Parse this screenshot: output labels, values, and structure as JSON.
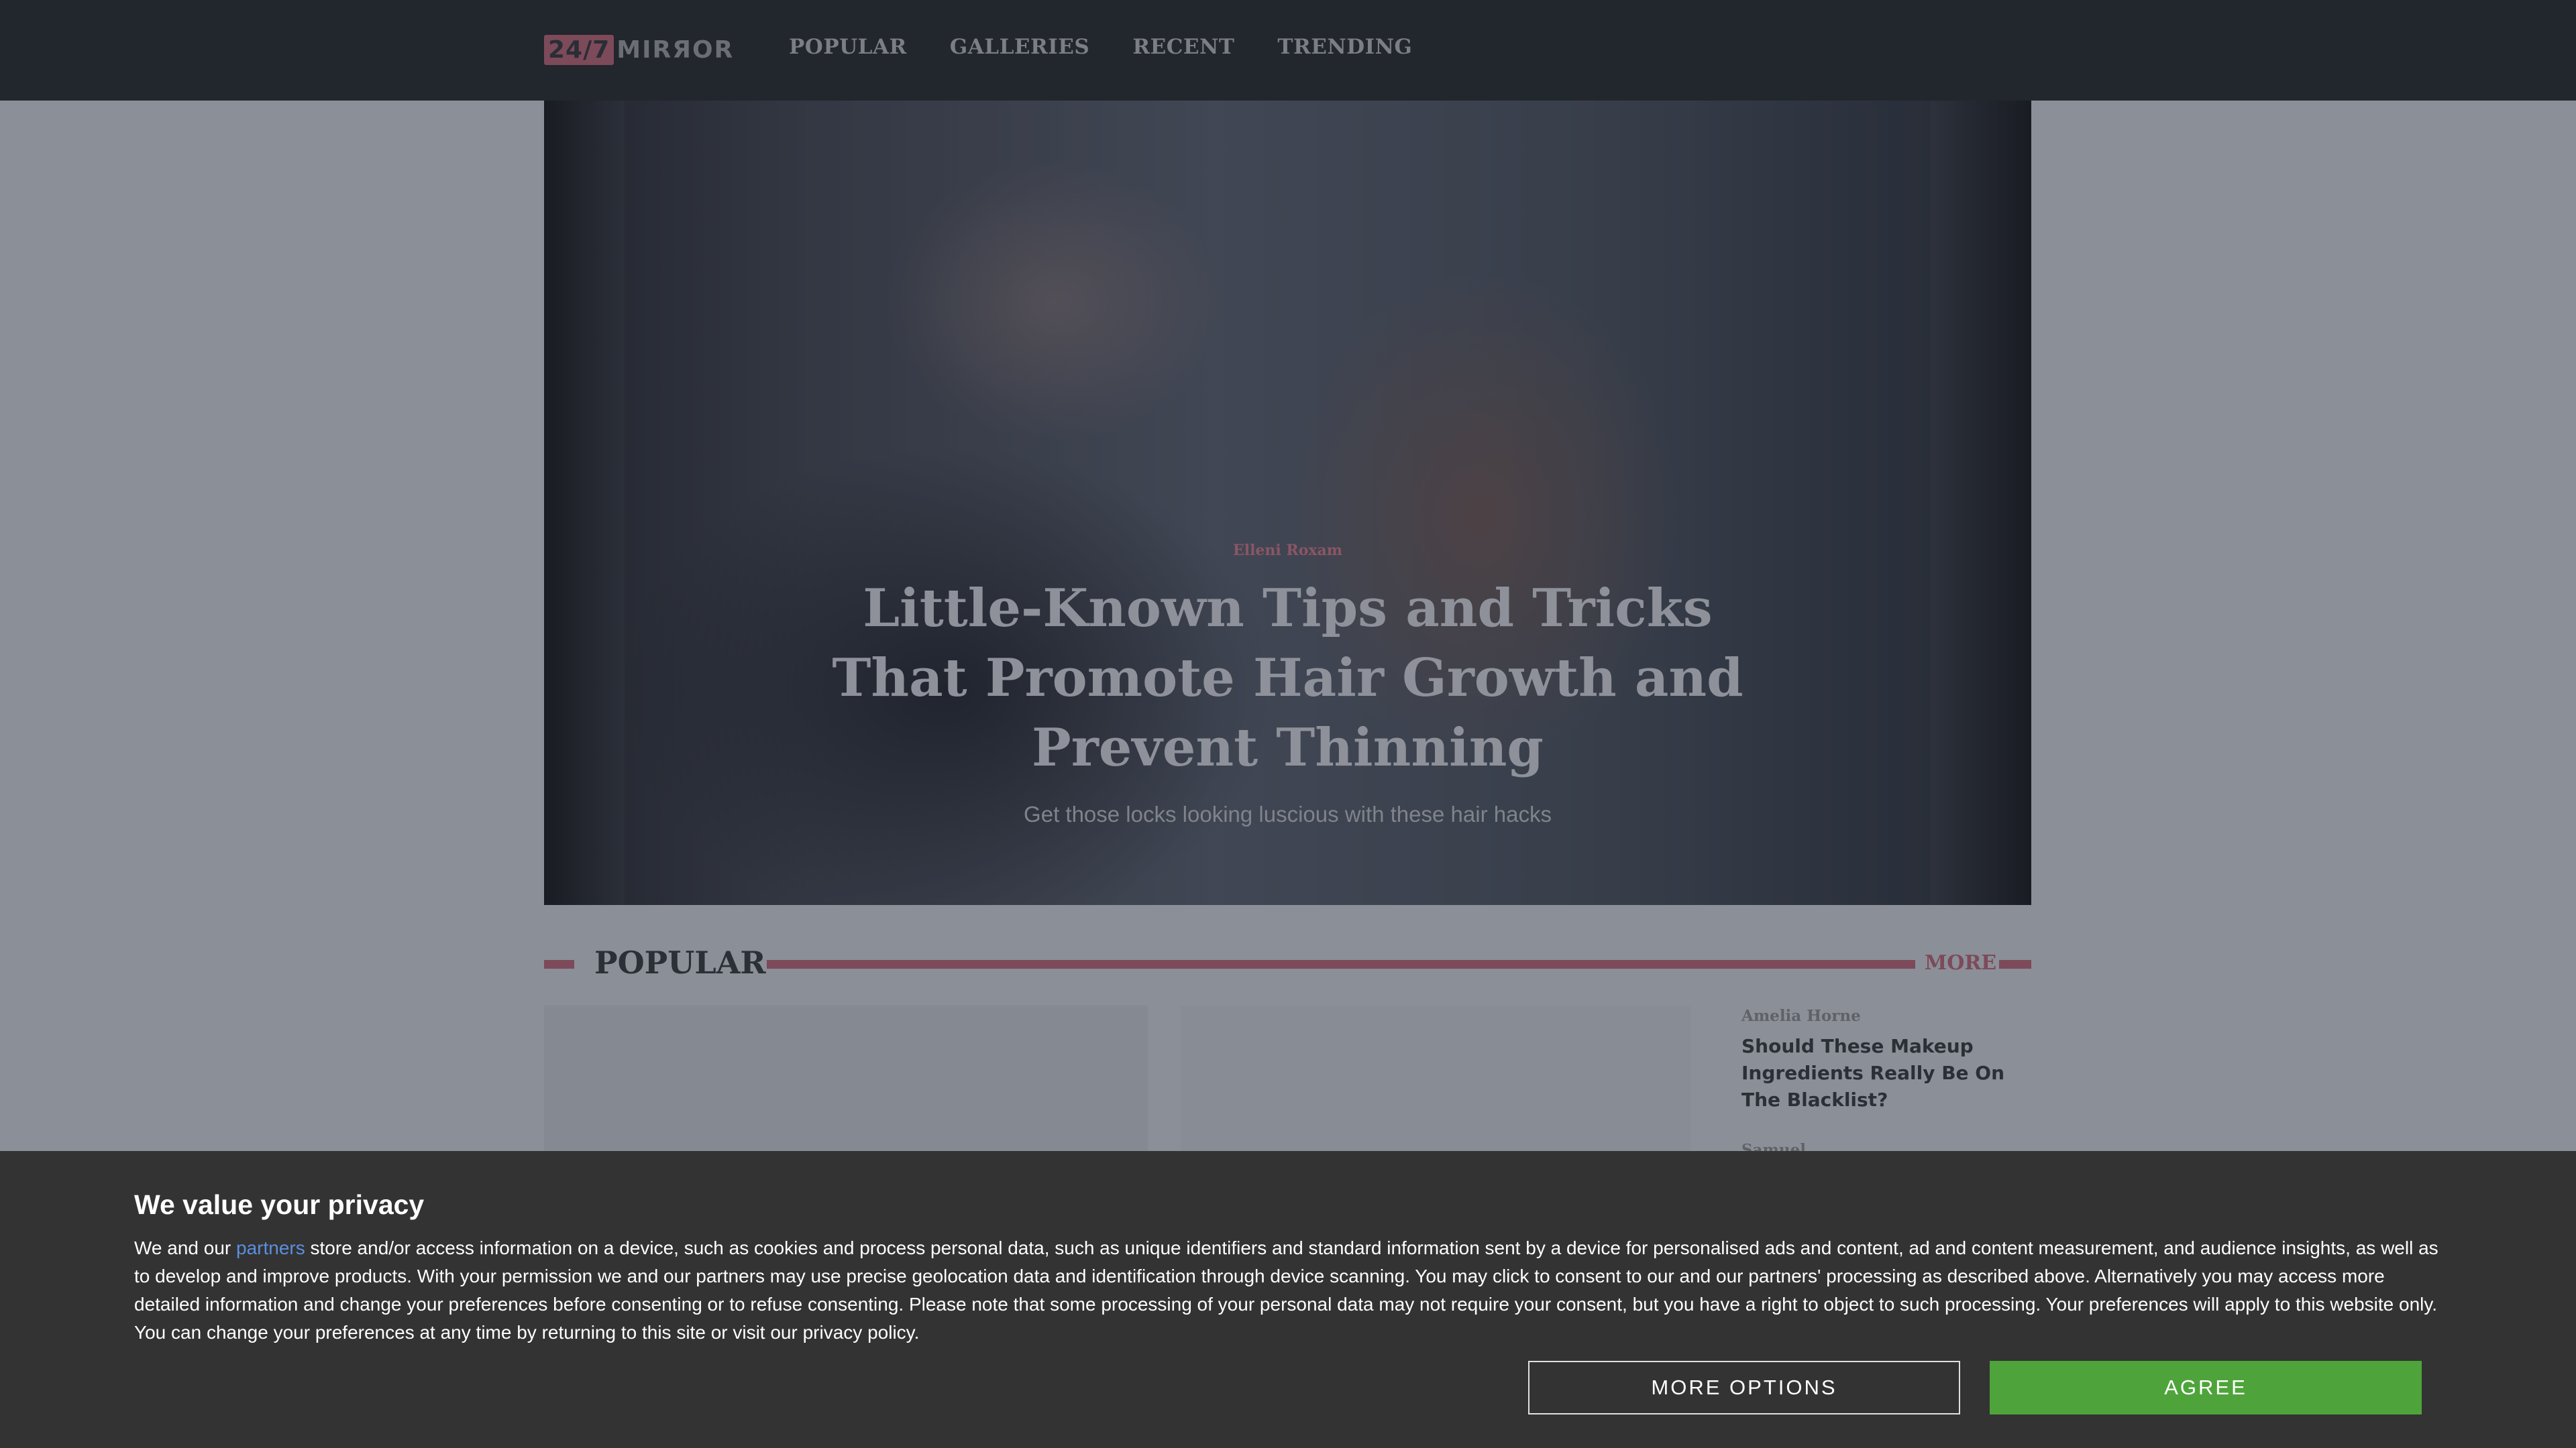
{
  "header": {
    "logo_badge": "24/7",
    "logo_word": "MIRЯOR",
    "nav": [
      "POPULAR",
      "GALLERIES",
      "RECENT",
      "TRENDING"
    ]
  },
  "hero": {
    "author": "Elleni Roxam",
    "title": "Little-Known Tips and Tricks That Promote Hair Growth and Prevent Thinning",
    "subtitle": "Get those locks looking luscious with these hair hacks"
  },
  "popular": {
    "heading": "POPULAR",
    "more": "MORE",
    "side_items": [
      {
        "author": "Amelia Horne",
        "title": "Should These Makeup Ingredients Really Be On The Blacklist?"
      },
      {
        "author": "Samuel ..."
      }
    ]
  },
  "consent": {
    "title": "We value your privacy",
    "body_prefix": "We and our ",
    "body_link": "partners",
    "body_rest": " store and/or access information on a device, such as cookies and process personal data, such as unique identifiers and standard information sent by a device for personalised ads and content, ad and content measurement, and audience insights, as well as to develop and improve products. With your permission we and our partners may use precise geolocation data and identification through device scanning. You may click to consent to our and our partners' processing as described above. Alternatively you may access more detailed information and change your preferences before consenting or to refuse consenting. Please note that some processing of your personal data may not require your consent, but you have a right to object to such processing. Your preferences will apply to this website only. You can change your preferences at any time by returning to this site or visit our privacy policy.",
    "more_options_label": "MORE OPTIONS",
    "agree_label": "AGREE"
  },
  "colors": {
    "header_bg": "#22262d",
    "accent": "#7d4a5a",
    "agree_green": "#4ea43a",
    "consent_bg": "#333333",
    "link_blue": "#5b8fe0"
  }
}
